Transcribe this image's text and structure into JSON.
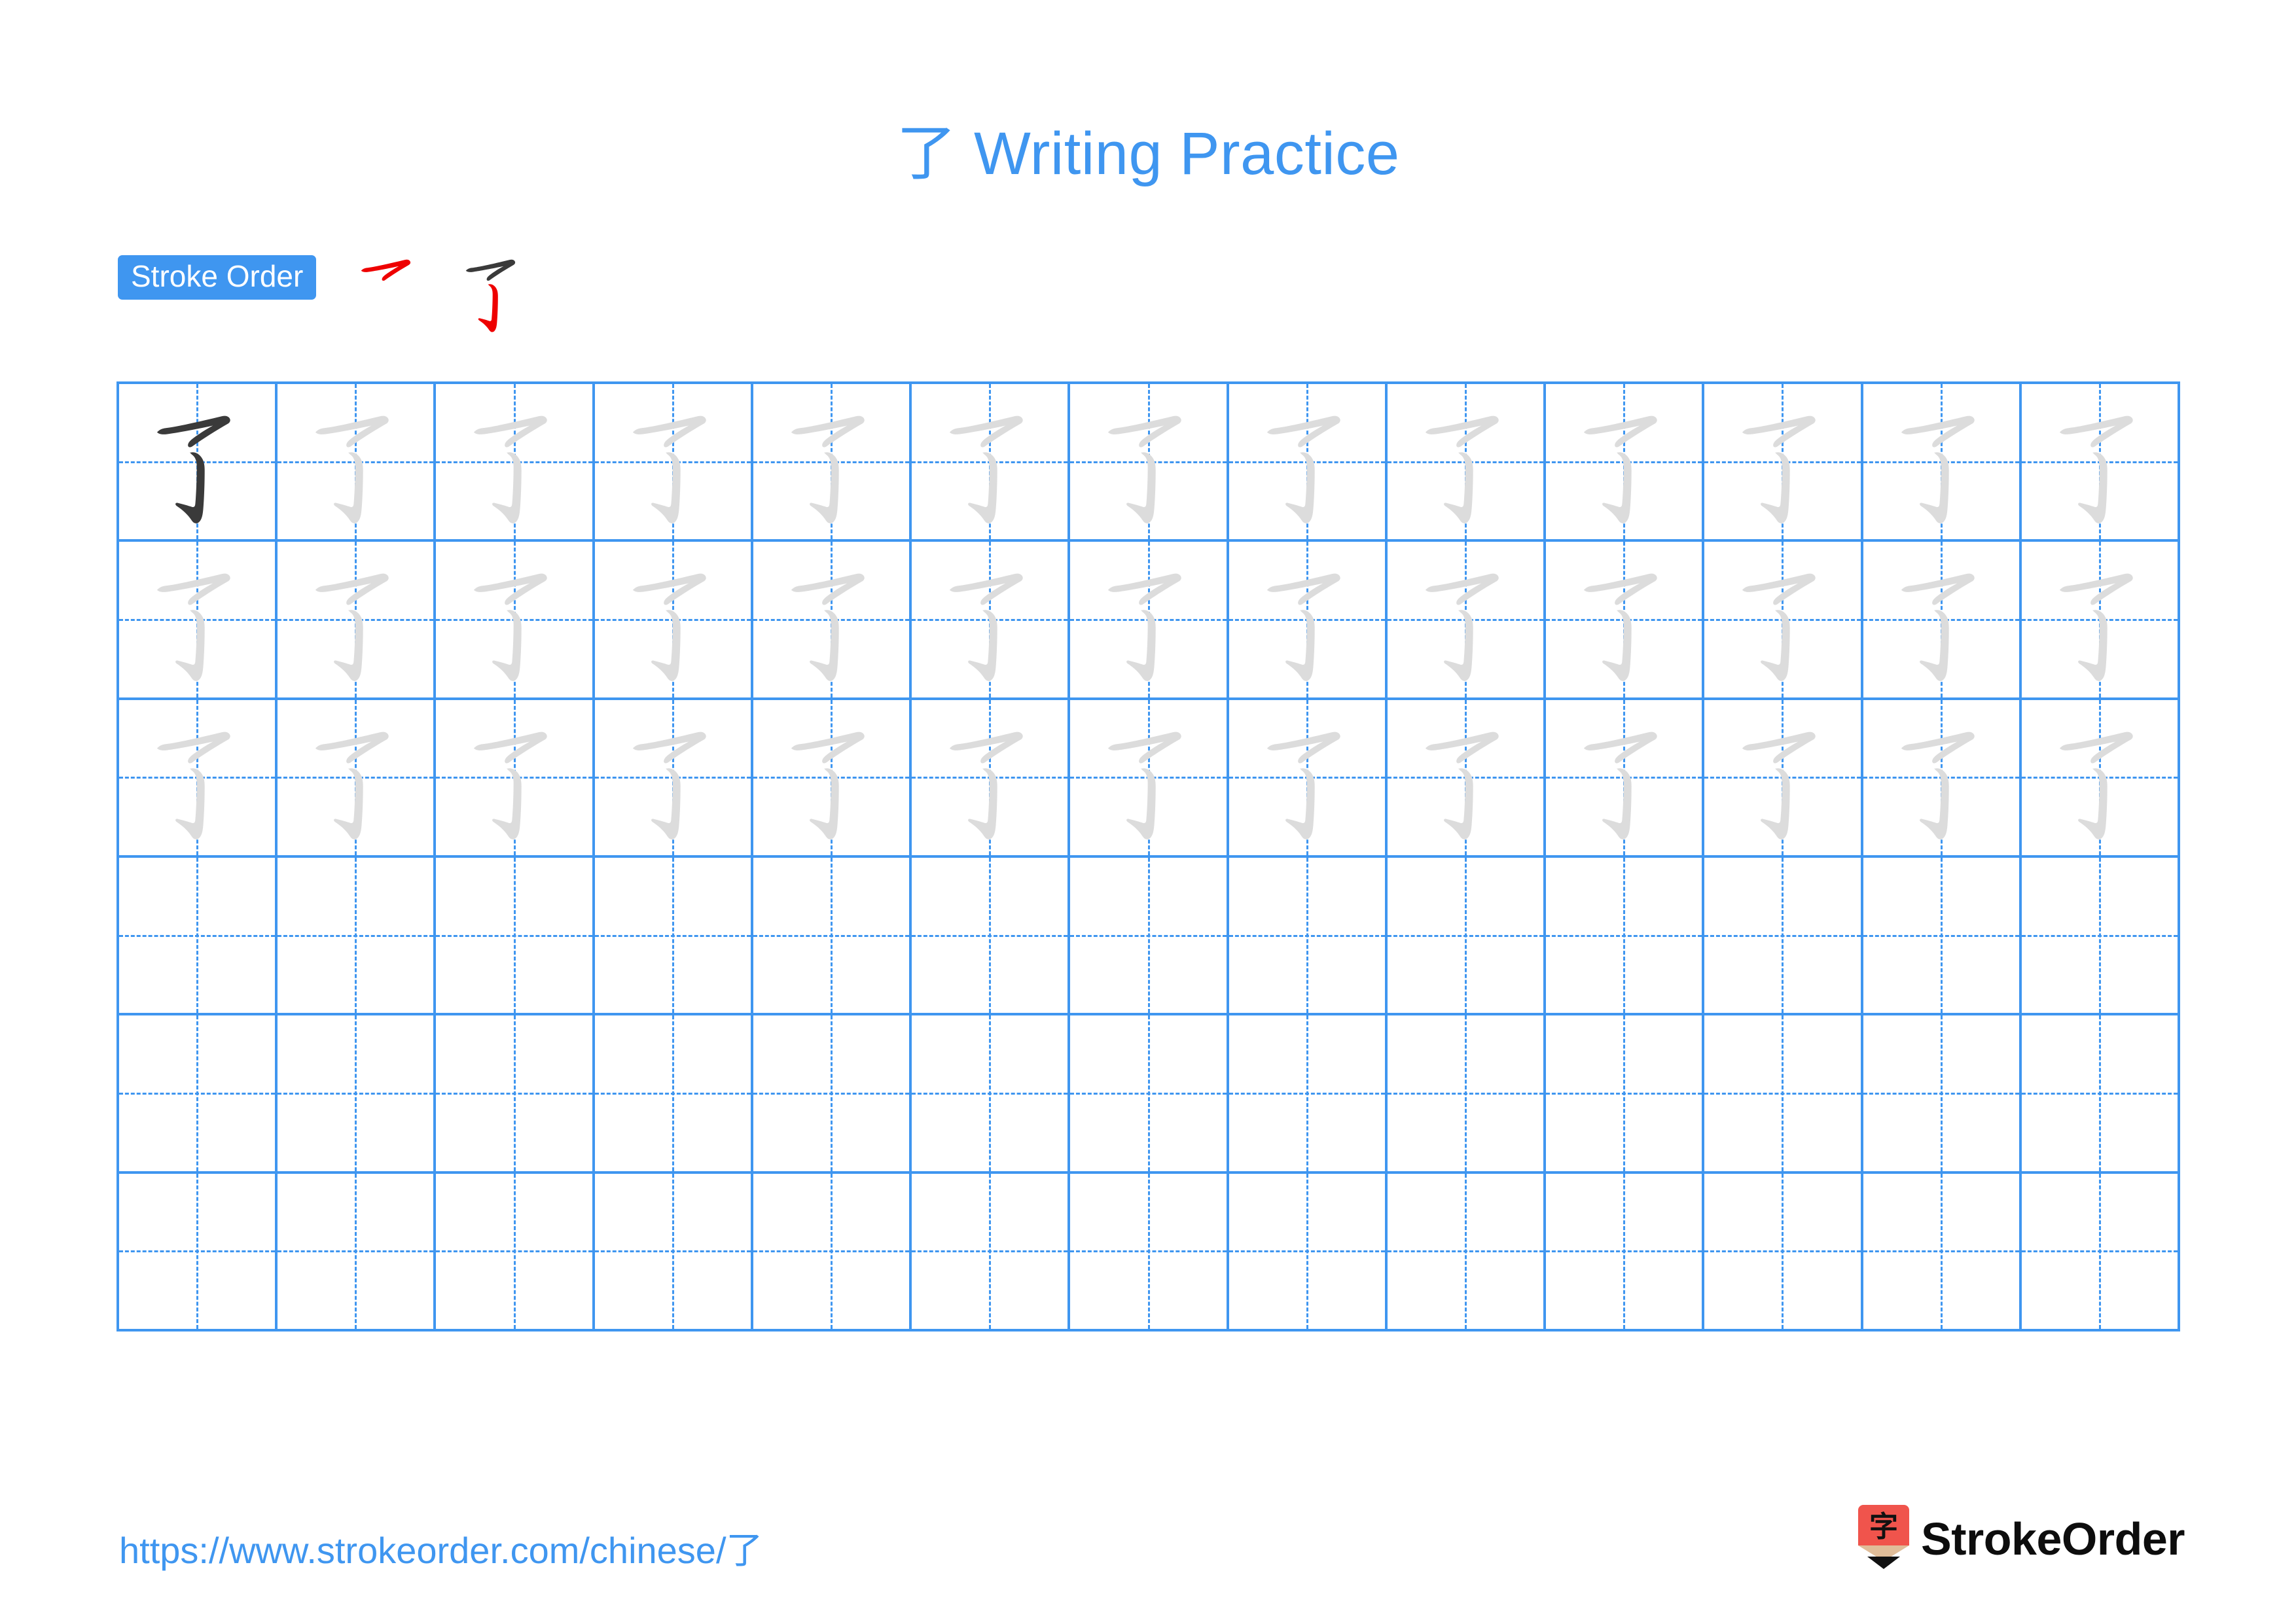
{
  "character": "了",
  "title": {
    "character": "了",
    "text": " Writing Practice",
    "full": "了 Writing Practice",
    "color": "#3f96f0"
  },
  "stroke_order": {
    "badge_label": "Stroke Order",
    "badge_bg": "#3f96f0",
    "badge_text_color": "#ffffff",
    "new_stroke_color": "#ee0000",
    "done_stroke_color": "#3a3a3a",
    "step_count": 2,
    "steps": [
      {
        "index": 1,
        "strokes_drawn": 1,
        "new_stroke": "horizontal-hook"
      },
      {
        "index": 2,
        "strokes_drawn": 2,
        "new_stroke": "vertical-hook"
      }
    ]
  },
  "grid": {
    "columns": 13,
    "rows": 6,
    "line_color": "#3f96f0",
    "guide_style": "dashed-crosshair",
    "model_char_color": "#3a3a3a",
    "trace_char_color": "#dcdcdc",
    "row_fill": [
      {
        "row": 1,
        "filled_cells": 13,
        "first_cell": "model"
      },
      {
        "row": 2,
        "filled_cells": 13,
        "first_cell": "trace"
      },
      {
        "row": 3,
        "filled_cells": 13,
        "first_cell": "trace"
      },
      {
        "row": 4,
        "filled_cells": 0,
        "first_cell": "empty"
      },
      {
        "row": 5,
        "filled_cells": 0,
        "first_cell": "empty"
      },
      {
        "row": 6,
        "filled_cells": 0,
        "first_cell": "empty"
      }
    ]
  },
  "footer": {
    "url": "https://www.strokeorder.com/chinese/了",
    "url_color": "#3f96f0",
    "brand_name": "StrokeOrder",
    "brand_mark_character": "字",
    "brand_mark_body_color": "#f0544c",
    "brand_mark_wood_color": "#e0bd99",
    "brand_mark_tip_color": "#111111"
  }
}
